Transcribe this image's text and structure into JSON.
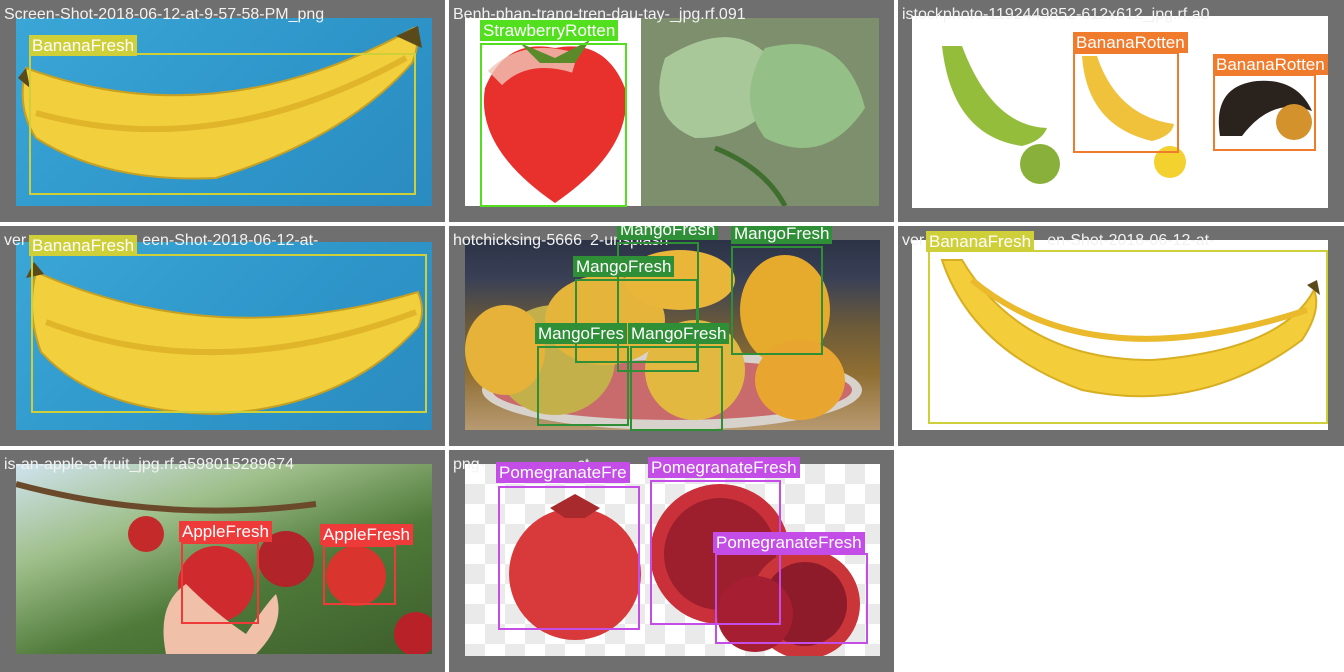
{
  "colors": {
    "tile_bg": "#6f6f6f",
    "label_text": "#ffffff",
    "banana_fresh": "#cfcf3a",
    "banana_rotten": "#f07b2c",
    "strawberry_rotten": "#52e01e",
    "mango_fresh": "#2e8f36",
    "apple_fresh": "#ef3a3a",
    "pomegranate_fresh": "#c44de8"
  },
  "tiles": [
    {
      "filename": "Screen-Shot-2018-06-12-at-9-57-58-PM_png",
      "background": "blue",
      "objects": [
        "banana"
      ],
      "detections": [
        {
          "label": "BananaFresh"
        }
      ]
    },
    {
      "filename": "Benh-phan-trang-tren-dau-tay-_jpg.rf.091",
      "background": "white",
      "objects": [
        "strawberry",
        "leaves"
      ],
      "detections": [
        {
          "label": "StrawberryRotten"
        }
      ]
    },
    {
      "filename": "istockphoto-1192449852-612x612_jpg.rf.a0",
      "background": "white",
      "objects": [
        "banana-green",
        "lime",
        "banana-ripe",
        "lemon",
        "banana-black",
        "mango-small"
      ],
      "detections": [
        {
          "label": "BananaRotten"
        },
        {
          "label": "BananaRotten"
        }
      ]
    },
    {
      "filename": "ver",
      "filename_tail": "een-Shot-2018-06-12-at-",
      "background": "blue",
      "objects": [
        "banana"
      ],
      "detections": [
        {
          "label": "BananaFresh"
        }
      ]
    },
    {
      "filename": "hotchicksing-5666",
      "filename_tail": "2-unsplash",
      "background": "mango",
      "objects": [
        "mango-bowl"
      ],
      "detections": [
        {
          "label": "MangoFresh"
        },
        {
          "label": "MangoFresh"
        },
        {
          "label": "MangoFresh"
        },
        {
          "label": "MangoFres"
        },
        {
          "label": "MangoFresh"
        }
      ]
    },
    {
      "filename": "ver",
      "filename_tail": "en-Shot-2018-06-12-at-",
      "background": "white",
      "objects": [
        "banana-large"
      ],
      "detections": [
        {
          "label": "BananaFresh"
        }
      ]
    },
    {
      "filename": "is-an-apple-a-fruit_jpg.rf.a598015289674",
      "background": "orchard",
      "objects": [
        "apple-tree"
      ],
      "detections": [
        {
          "label": "AppleFresh"
        },
        {
          "label": "AppleFresh"
        }
      ]
    },
    {
      "filename": "png-",
      "filename_tail": "ct",
      "background": "checker",
      "objects": [
        "pomegranates"
      ],
      "detections": [
        {
          "label": "PomegranateFre"
        },
        {
          "label": "PomegranateFresh"
        },
        {
          "label": "PomegranateFresh"
        }
      ]
    }
  ]
}
